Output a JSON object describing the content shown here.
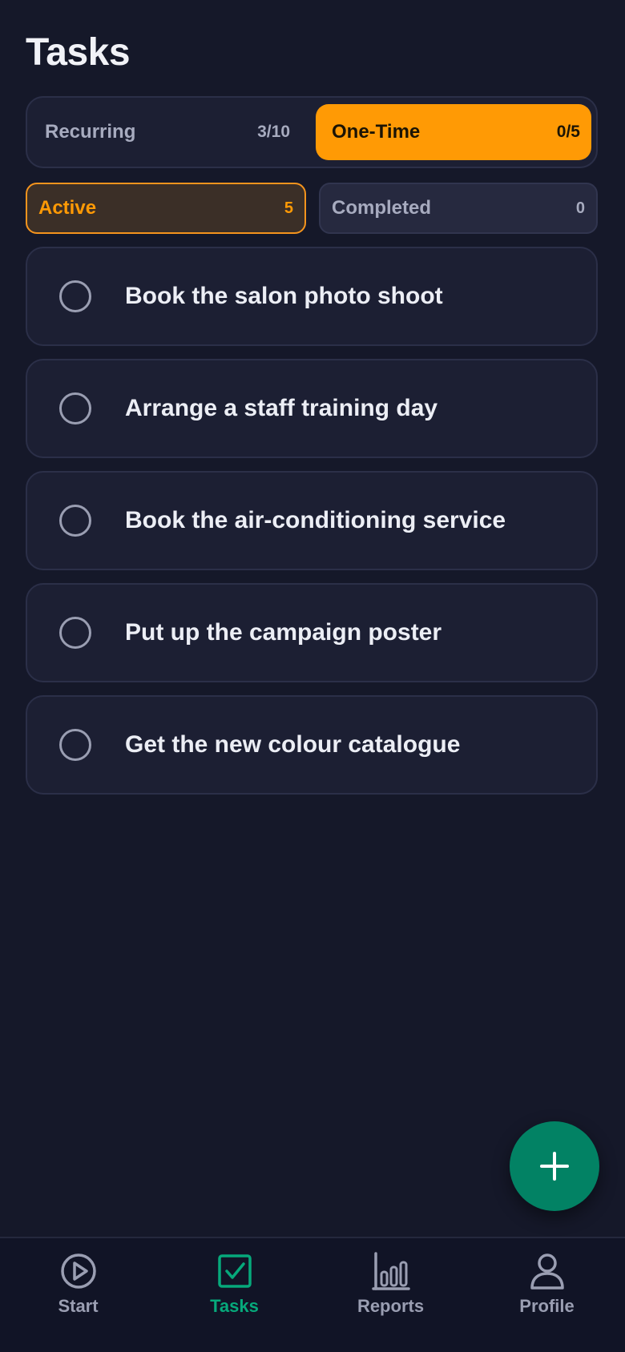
{
  "header": {
    "title": "Tasks"
  },
  "segments": {
    "recurring": {
      "label": "Recurring",
      "count": "3/10"
    },
    "one_time": {
      "label": "One-Time",
      "count": "0/5",
      "selected": true
    }
  },
  "filters": {
    "active": {
      "label": "Active",
      "count": "5",
      "selected": true
    },
    "completed": {
      "label": "Completed",
      "count": "0"
    }
  },
  "tasks": [
    {
      "title": "Book the salon photo shoot",
      "done": false
    },
    {
      "title": "Arrange a staff training day",
      "done": false
    },
    {
      "title": "Book the air-conditioning service",
      "done": false
    },
    {
      "title": "Put up the campaign poster",
      "done": false
    },
    {
      "title": "Get the new colour catalogue",
      "done": false
    }
  ],
  "fab": {
    "icon": "plus-icon"
  },
  "nav": {
    "items": [
      {
        "label": "Start",
        "icon": "play-circle-icon",
        "active": false
      },
      {
        "label": "Tasks",
        "icon": "checkbox-icon",
        "active": true
      },
      {
        "label": "Reports",
        "icon": "bar-chart-icon",
        "active": false
      },
      {
        "label": "Profile",
        "icon": "person-icon",
        "active": false
      }
    ]
  },
  "colors": {
    "background": "#151829",
    "accent_orange": "#ff9a05",
    "accent_green": "#028264",
    "nav_active": "#06a97b",
    "muted_text": "#9a9eb2"
  }
}
